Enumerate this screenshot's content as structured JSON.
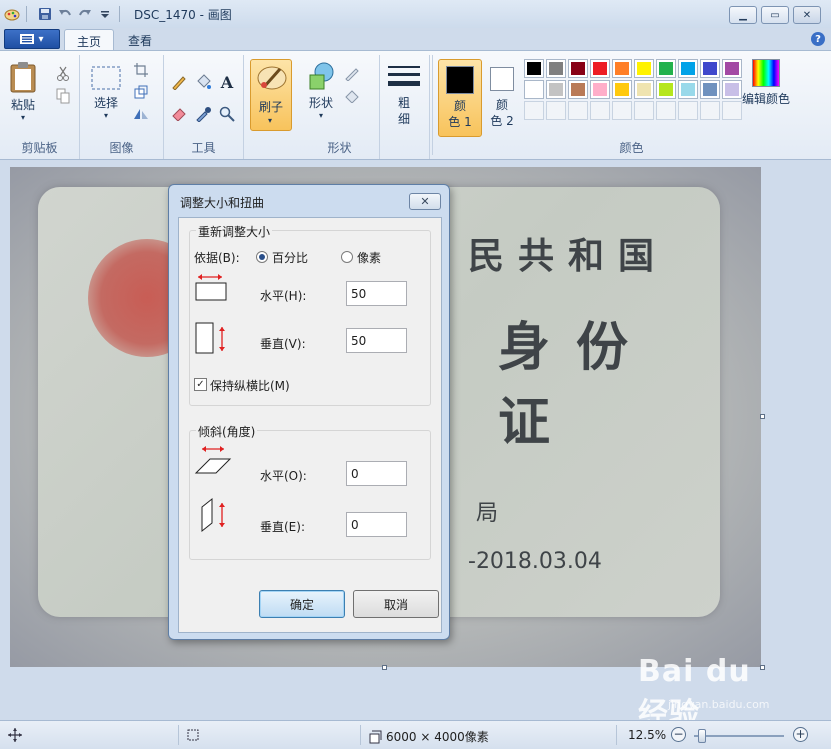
{
  "window": {
    "title": "DSC_1470 - 画图",
    "minimize_icon": "minimize-icon",
    "maximize_icon": "maximize-icon",
    "close_icon": "close-icon"
  },
  "tabs": [
    {
      "label": "主页",
      "active": true
    },
    {
      "label": "查看",
      "active": false
    }
  ],
  "ribbon": {
    "clipboard": {
      "group": "剪贴板",
      "paste": "粘贴"
    },
    "image": {
      "group": "图像",
      "select": "选择"
    },
    "tools": {
      "group": "工具"
    },
    "brushes": {
      "label": "刷子"
    },
    "shapes": {
      "group": "形状",
      "label": "形状"
    },
    "size": {
      "label": "粗\n细"
    },
    "colors": {
      "group": "颜色",
      "color1": {
        "label": "颜\n色 1",
        "value": "#000000"
      },
      "color2": {
        "label": "颜\n色 2",
        "value": "#ffffff"
      },
      "edit": "编辑颜色",
      "palette_row1": [
        "#000000",
        "#7f7f7f",
        "#880015",
        "#ed1c24",
        "#ff7f27",
        "#fff200",
        "#22b14c",
        "#00a2e8",
        "#3f48cc",
        "#a349a4"
      ],
      "palette_row2": [
        "#ffffff",
        "#c3c3c3",
        "#b97a57",
        "#ffaec9",
        "#ffc90e",
        "#efe4b0",
        "#b5e61d",
        "#99d9ea",
        "#7092be",
        "#c8bfe7"
      ]
    }
  },
  "image_content": {
    "line1": "民共和国",
    "line2": "身份证",
    "line3": "局",
    "line4": "-2018.03.04"
  },
  "dialog": {
    "title": "调整大小和扭曲",
    "resize_legend": "重新调整大小",
    "by_label": "依据(B):",
    "percent": "百分比",
    "pixels": "像素",
    "horizontal_label": "水平(H):",
    "horizontal_value": "50",
    "vertical_label": "垂直(V):",
    "vertical_value": "50",
    "keep_ratio": "保持纵横比(M)",
    "skew_legend": "倾斜(角度)",
    "skew_h_label": "水平(O):",
    "skew_h_value": "0",
    "skew_v_label": "垂直(E):",
    "skew_v_value": "0",
    "ok": "确定",
    "cancel": "取消"
  },
  "statusbar": {
    "size": "6000 × 4000像素",
    "zoom": "12.5%",
    "zoom_level": 0.05
  },
  "watermark": {
    "text": "Bai du 经验",
    "sub": "jingyan.baidu.com"
  }
}
